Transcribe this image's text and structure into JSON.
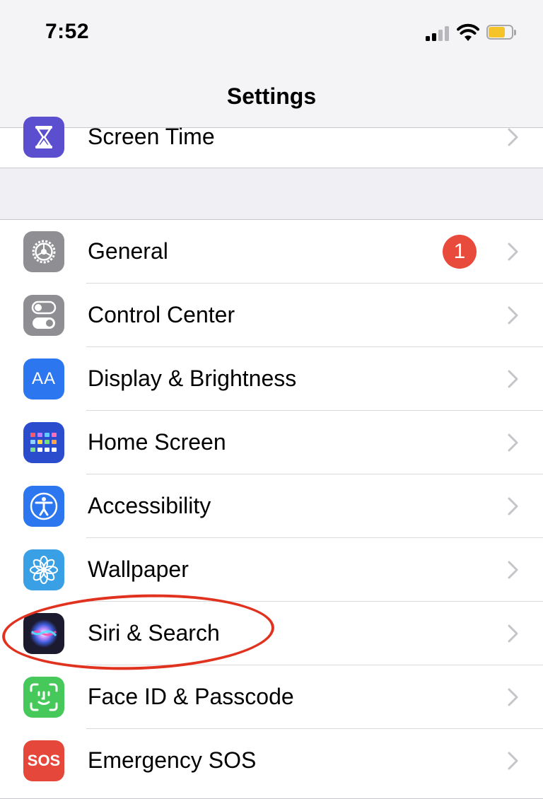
{
  "status_bar": {
    "time": "7:52"
  },
  "nav": {
    "title": "Settings"
  },
  "colors": {
    "accent_badge": "#e84a3b",
    "annotation": "#e0321f",
    "battery": "#f5c428"
  },
  "top_group": [
    {
      "label": "Screen Time",
      "icon": "hourglass-icon",
      "icon_color": "#5b4fcf"
    }
  ],
  "main_group": [
    {
      "label": "General",
      "icon": "gear-icon",
      "icon_color": "#8e8e93",
      "badge": "1"
    },
    {
      "label": "Control Center",
      "icon": "toggle-switches-icon",
      "icon_color": "#8e8e93"
    },
    {
      "label": "Display & Brightness",
      "icon": "text-size-icon",
      "icon_color": "#2c76f0",
      "icon_text": "AA"
    },
    {
      "label": "Home Screen",
      "icon": "app-grid-icon",
      "icon_color": "#2b4ccd"
    },
    {
      "label": "Accessibility",
      "icon": "accessibility-person-icon",
      "icon_color": "#2c76f0"
    },
    {
      "label": "Wallpaper",
      "icon": "flower-icon",
      "icon_color": "#3aa0e6"
    },
    {
      "label": "Siri & Search",
      "icon": "siri-icon",
      "icon_color": "#1b1a2e"
    },
    {
      "label": "Face ID & Passcode",
      "icon": "face-id-icon",
      "icon_color": "#46c85a"
    },
    {
      "label": "Emergency SOS",
      "icon": "sos-icon",
      "icon_color": "#e5473a",
      "icon_text": "SOS"
    }
  ]
}
